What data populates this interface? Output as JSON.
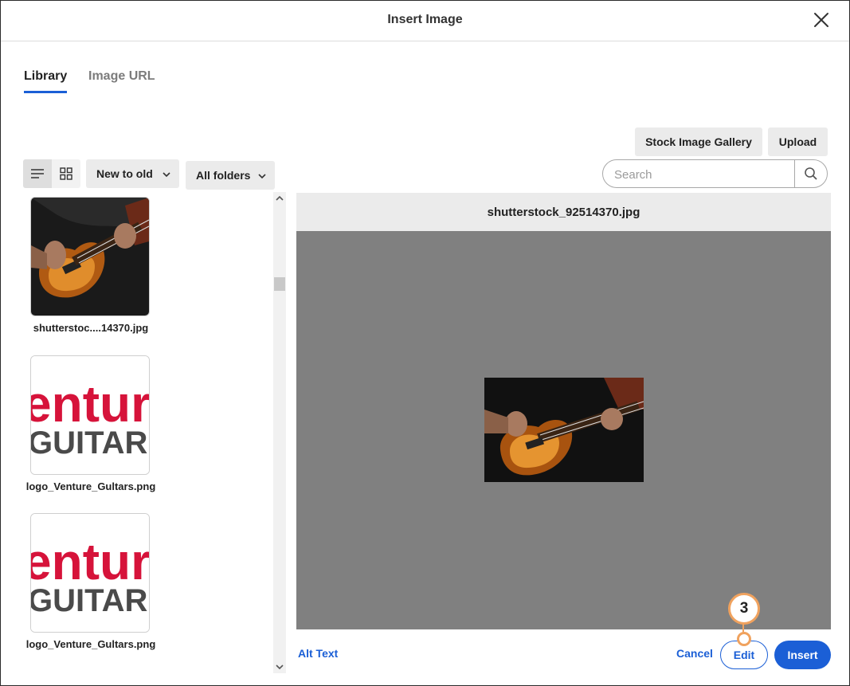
{
  "dialog": {
    "title": "Insert Image"
  },
  "tabs": [
    {
      "label": "Library",
      "active": true
    },
    {
      "label": "Image URL",
      "active": false
    }
  ],
  "toolbar": {
    "stock_gallery_label": "Stock Image Gallery",
    "upload_label": "Upload",
    "sort_selected": "New to old",
    "folder_selected": "All folders",
    "search_placeholder": "Search",
    "view_mode": "list"
  },
  "files": [
    {
      "name": "shutterstoc....14370.jpg",
      "thumbnail": "guitar-photo"
    },
    {
      "name": "logo_Venture_Gultars.png",
      "thumbnail": "venture-guitars-logo"
    },
    {
      "name": "logo_Venture_Gultars.png",
      "thumbnail": "venture-guitars-logo"
    }
  ],
  "logo_text": {
    "top": "entur",
    "bottom": "GUITAR"
  },
  "preview": {
    "filename": "shutterstock_92514370.jpg"
  },
  "footer": {
    "alt_text_label": "Alt Text",
    "cancel_label": "Cancel",
    "edit_label": "Edit",
    "insert_label": "Insert"
  },
  "callout": {
    "number": "3"
  },
  "colors": {
    "accent": "#1b5fd6",
    "callout": "#f0a25e",
    "preview_background": "#808080",
    "logo_red": "#d6133a",
    "logo_grey": "#4a4a4a"
  },
  "icons": [
    "close-icon",
    "list-view-icon",
    "grid-view-icon",
    "chevron-down-icon",
    "search-icon",
    "scroll-up-icon",
    "scroll-down-icon"
  ]
}
